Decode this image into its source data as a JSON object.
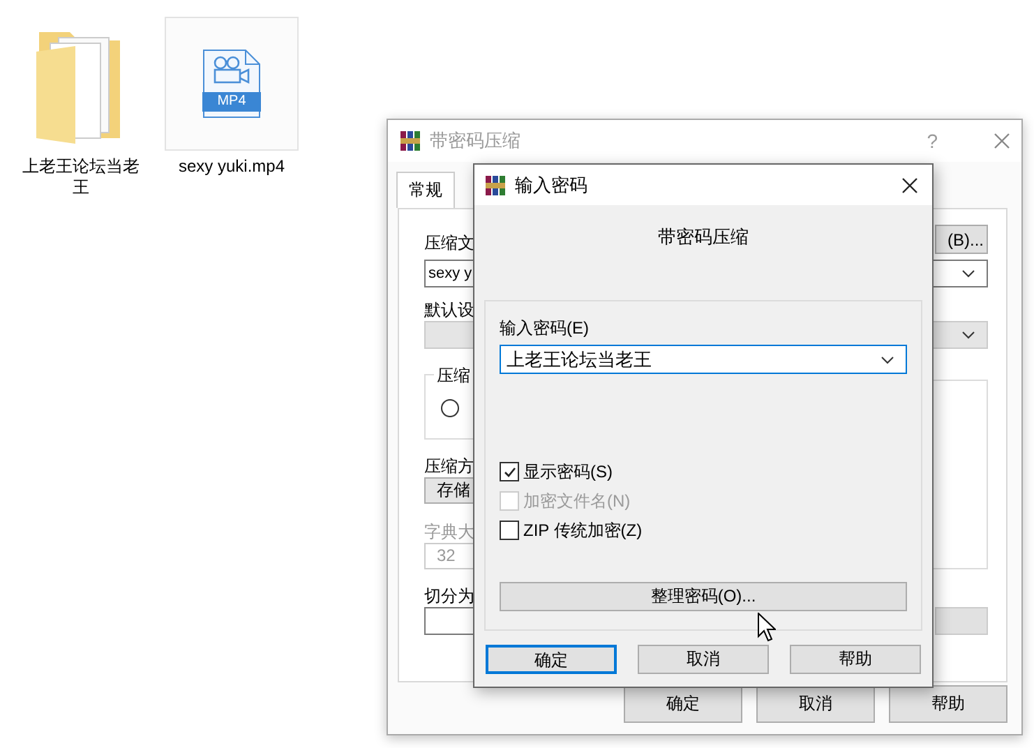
{
  "desktop_icons": [
    {
      "kind": "folder",
      "label": "上老王论坛当老王",
      "selected": false
    },
    {
      "kind": "video",
      "label": "sexy yuki.mp4",
      "badge": "MP4",
      "selected": true
    }
  ],
  "back_window": {
    "title": "带密码压缩",
    "help": "?",
    "tabs": [
      {
        "label": "常规",
        "selected": true
      }
    ],
    "archive_name_label": "压缩文",
    "browse_button": "(B)...",
    "archive_name_value": "sexy y",
    "profile_label": "默认设",
    "format_group_label": "压缩",
    "format_radio": {
      "selected": false
    },
    "method_label": "压缩方",
    "method_value": "存储",
    "dictionary_label": "字典大",
    "dictionary_value": "32",
    "split_label": "切分为",
    "buttons": [
      "确定",
      "取消",
      "帮助"
    ]
  },
  "password_dialog": {
    "title": "输入密码",
    "heading": "带密码压缩",
    "password_label": "输入密码(E)",
    "password_value": "上老王论坛当老王",
    "checkboxes": [
      {
        "label": "显示密码(S)",
        "checked": true,
        "disabled": false
      },
      {
        "label": "加密文件名(N)",
        "checked": false,
        "disabled": true
      },
      {
        "label": "ZIP 传统加密(Z)",
        "checked": false,
        "disabled": false
      }
    ],
    "manage_button": "整理密码(O)...",
    "buttons": [
      {
        "label": "确定",
        "default": true
      },
      {
        "label": "取消",
        "default": false
      },
      {
        "label": "帮助",
        "default": false
      }
    ]
  }
}
